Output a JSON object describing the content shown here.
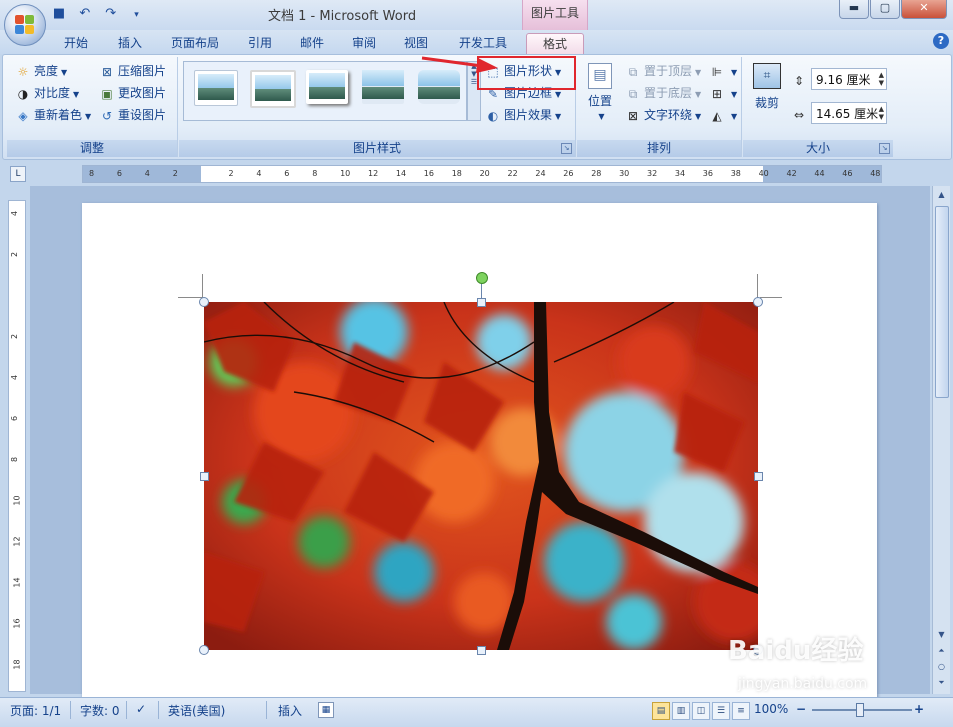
{
  "window": {
    "title": "文档 1 - Microsoft Word",
    "context_tool": "图片工具",
    "controls": {
      "min": "▬",
      "max": "▢",
      "close": "✕"
    }
  },
  "qat": {
    "icons": [
      "save-icon",
      "undo-icon",
      "redo-icon",
      "customize-icon"
    ],
    "glyphs": [
      "■",
      "↶",
      "↷",
      "▾"
    ]
  },
  "tabs": [
    {
      "label": "开始"
    },
    {
      "label": "插入"
    },
    {
      "label": "页面布局"
    },
    {
      "label": "引用"
    },
    {
      "label": "邮件"
    },
    {
      "label": "审阅"
    },
    {
      "label": "视图"
    },
    {
      "label": "开发工具"
    },
    {
      "label": "格式",
      "active": true
    }
  ],
  "ribbon": {
    "adjust": {
      "label": "调整",
      "brightness": "亮度",
      "contrast": "对比度",
      "recolor": "重新着色",
      "compress": "压缩图片",
      "change": "更改图片",
      "reset": "重设图片"
    },
    "styles": {
      "label": "图片样式",
      "shape": "图片形状",
      "border": "图片边框",
      "effects": "图片效果"
    },
    "arrange": {
      "label": "排列",
      "position": "位置",
      "front": "置于顶层",
      "back": "置于底层",
      "wrap": "文字环绕"
    },
    "size": {
      "label": "大小",
      "crop": "裁剪",
      "height": "9.16 厘米",
      "width": "14.65 厘米"
    }
  },
  "ruler": {
    "corner": "L",
    "h_ticks": [
      "8",
      "6",
      "4",
      "2",
      "",
      "2",
      "4",
      "6",
      "8",
      "10",
      "12",
      "14",
      "16",
      "18",
      "20",
      "22",
      "24",
      "26",
      "28",
      "30",
      "32",
      "34",
      "36",
      "38",
      "40",
      "42",
      "44",
      "46",
      "48"
    ],
    "v_ticks": [
      "4",
      "2",
      "",
      "2",
      "4",
      "6",
      "8",
      "10",
      "12",
      "14",
      "16",
      "18"
    ]
  },
  "status": {
    "page": "页面: 1/1",
    "words": "字数: 0",
    "language": "英语(美国)",
    "mode": "插入",
    "zoom": "100%",
    "zoom_minus": "−",
    "zoom_plus": "+"
  },
  "watermark": {
    "main": "Baidu经验",
    "sub": "jingyan.baidu.com"
  },
  "colors": {
    "highlight": "#e0262d",
    "context_tab": "#e6bfd9",
    "ribbon_text": "#15428b"
  }
}
